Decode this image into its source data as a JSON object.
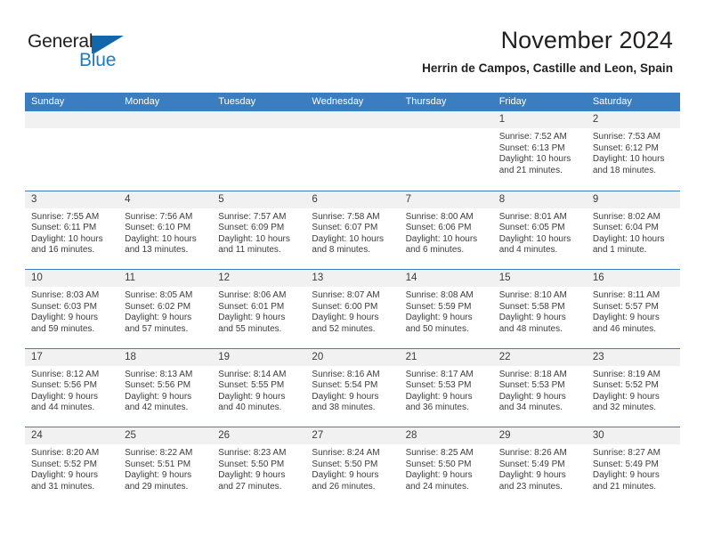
{
  "brand": {
    "name_part1": "General",
    "name_part2": "Blue",
    "flag_color": "#1466ab",
    "accent_color": "#1d7cc4"
  },
  "header": {
    "title": "November 2024",
    "subtitle": "Herrin de Campos, Castille and Leon, Spain"
  },
  "colors": {
    "header_row_bg": "#3a7ec1",
    "day_number_bg": "#f1f1f1",
    "text": "#3c3c3c",
    "page_bg": "#ffffff"
  },
  "weekdays": [
    "Sunday",
    "Monday",
    "Tuesday",
    "Wednesday",
    "Thursday",
    "Friday",
    "Saturday"
  ],
  "weeks": [
    [
      {
        "day": "",
        "empty": true,
        "sunrise": "",
        "sunset": "",
        "daylight1": "",
        "daylight2": ""
      },
      {
        "day": "",
        "empty": true,
        "sunrise": "",
        "sunset": "",
        "daylight1": "",
        "daylight2": ""
      },
      {
        "day": "",
        "empty": true,
        "sunrise": "",
        "sunset": "",
        "daylight1": "",
        "daylight2": ""
      },
      {
        "day": "",
        "empty": true,
        "sunrise": "",
        "sunset": "",
        "daylight1": "",
        "daylight2": ""
      },
      {
        "day": "",
        "empty": true,
        "sunrise": "",
        "sunset": "",
        "daylight1": "",
        "daylight2": ""
      },
      {
        "day": "1",
        "empty": false,
        "sunrise": "Sunrise: 7:52 AM",
        "sunset": "Sunset: 6:13 PM",
        "daylight1": "Daylight: 10 hours",
        "daylight2": "and 21 minutes."
      },
      {
        "day": "2",
        "empty": false,
        "sunrise": "Sunrise: 7:53 AM",
        "sunset": "Sunset: 6:12 PM",
        "daylight1": "Daylight: 10 hours",
        "daylight2": "and 18 minutes."
      }
    ],
    [
      {
        "day": "3",
        "empty": false,
        "sunrise": "Sunrise: 7:55 AM",
        "sunset": "Sunset: 6:11 PM",
        "daylight1": "Daylight: 10 hours",
        "daylight2": "and 16 minutes."
      },
      {
        "day": "4",
        "empty": false,
        "sunrise": "Sunrise: 7:56 AM",
        "sunset": "Sunset: 6:10 PM",
        "daylight1": "Daylight: 10 hours",
        "daylight2": "and 13 minutes."
      },
      {
        "day": "5",
        "empty": false,
        "sunrise": "Sunrise: 7:57 AM",
        "sunset": "Sunset: 6:09 PM",
        "daylight1": "Daylight: 10 hours",
        "daylight2": "and 11 minutes."
      },
      {
        "day": "6",
        "empty": false,
        "sunrise": "Sunrise: 7:58 AM",
        "sunset": "Sunset: 6:07 PM",
        "daylight1": "Daylight: 10 hours",
        "daylight2": "and 8 minutes."
      },
      {
        "day": "7",
        "empty": false,
        "sunrise": "Sunrise: 8:00 AM",
        "sunset": "Sunset: 6:06 PM",
        "daylight1": "Daylight: 10 hours",
        "daylight2": "and 6 minutes."
      },
      {
        "day": "8",
        "empty": false,
        "sunrise": "Sunrise: 8:01 AM",
        "sunset": "Sunset: 6:05 PM",
        "daylight1": "Daylight: 10 hours",
        "daylight2": "and 4 minutes."
      },
      {
        "day": "9",
        "empty": false,
        "sunrise": "Sunrise: 8:02 AM",
        "sunset": "Sunset: 6:04 PM",
        "daylight1": "Daylight: 10 hours",
        "daylight2": "and 1 minute."
      }
    ],
    [
      {
        "day": "10",
        "empty": false,
        "sunrise": "Sunrise: 8:03 AM",
        "sunset": "Sunset: 6:03 PM",
        "daylight1": "Daylight: 9 hours",
        "daylight2": "and 59 minutes."
      },
      {
        "day": "11",
        "empty": false,
        "sunrise": "Sunrise: 8:05 AM",
        "sunset": "Sunset: 6:02 PM",
        "daylight1": "Daylight: 9 hours",
        "daylight2": "and 57 minutes."
      },
      {
        "day": "12",
        "empty": false,
        "sunrise": "Sunrise: 8:06 AM",
        "sunset": "Sunset: 6:01 PM",
        "daylight1": "Daylight: 9 hours",
        "daylight2": "and 55 minutes."
      },
      {
        "day": "13",
        "empty": false,
        "sunrise": "Sunrise: 8:07 AM",
        "sunset": "Sunset: 6:00 PM",
        "daylight1": "Daylight: 9 hours",
        "daylight2": "and 52 minutes."
      },
      {
        "day": "14",
        "empty": false,
        "sunrise": "Sunrise: 8:08 AM",
        "sunset": "Sunset: 5:59 PM",
        "daylight1": "Daylight: 9 hours",
        "daylight2": "and 50 minutes."
      },
      {
        "day": "15",
        "empty": false,
        "sunrise": "Sunrise: 8:10 AM",
        "sunset": "Sunset: 5:58 PM",
        "daylight1": "Daylight: 9 hours",
        "daylight2": "and 48 minutes."
      },
      {
        "day": "16",
        "empty": false,
        "sunrise": "Sunrise: 8:11 AM",
        "sunset": "Sunset: 5:57 PM",
        "daylight1": "Daylight: 9 hours",
        "daylight2": "and 46 minutes."
      }
    ],
    [
      {
        "day": "17",
        "empty": false,
        "sunrise": "Sunrise: 8:12 AM",
        "sunset": "Sunset: 5:56 PM",
        "daylight1": "Daylight: 9 hours",
        "daylight2": "and 44 minutes."
      },
      {
        "day": "18",
        "empty": false,
        "sunrise": "Sunrise: 8:13 AM",
        "sunset": "Sunset: 5:56 PM",
        "daylight1": "Daylight: 9 hours",
        "daylight2": "and 42 minutes."
      },
      {
        "day": "19",
        "empty": false,
        "sunrise": "Sunrise: 8:14 AM",
        "sunset": "Sunset: 5:55 PM",
        "daylight1": "Daylight: 9 hours",
        "daylight2": "and 40 minutes."
      },
      {
        "day": "20",
        "empty": false,
        "sunrise": "Sunrise: 8:16 AM",
        "sunset": "Sunset: 5:54 PM",
        "daylight1": "Daylight: 9 hours",
        "daylight2": "and 38 minutes."
      },
      {
        "day": "21",
        "empty": false,
        "sunrise": "Sunrise: 8:17 AM",
        "sunset": "Sunset: 5:53 PM",
        "daylight1": "Daylight: 9 hours",
        "daylight2": "and 36 minutes."
      },
      {
        "day": "22",
        "empty": false,
        "sunrise": "Sunrise: 8:18 AM",
        "sunset": "Sunset: 5:53 PM",
        "daylight1": "Daylight: 9 hours",
        "daylight2": "and 34 minutes."
      },
      {
        "day": "23",
        "empty": false,
        "sunrise": "Sunrise: 8:19 AM",
        "sunset": "Sunset: 5:52 PM",
        "daylight1": "Daylight: 9 hours",
        "daylight2": "and 32 minutes."
      }
    ],
    [
      {
        "day": "24",
        "empty": false,
        "sunrise": "Sunrise: 8:20 AM",
        "sunset": "Sunset: 5:52 PM",
        "daylight1": "Daylight: 9 hours",
        "daylight2": "and 31 minutes."
      },
      {
        "day": "25",
        "empty": false,
        "sunrise": "Sunrise: 8:22 AM",
        "sunset": "Sunset: 5:51 PM",
        "daylight1": "Daylight: 9 hours",
        "daylight2": "and 29 minutes."
      },
      {
        "day": "26",
        "empty": false,
        "sunrise": "Sunrise: 8:23 AM",
        "sunset": "Sunset: 5:50 PM",
        "daylight1": "Daylight: 9 hours",
        "daylight2": "and 27 minutes."
      },
      {
        "day": "27",
        "empty": false,
        "sunrise": "Sunrise: 8:24 AM",
        "sunset": "Sunset: 5:50 PM",
        "daylight1": "Daylight: 9 hours",
        "daylight2": "and 26 minutes."
      },
      {
        "day": "28",
        "empty": false,
        "sunrise": "Sunrise: 8:25 AM",
        "sunset": "Sunset: 5:50 PM",
        "daylight1": "Daylight: 9 hours",
        "daylight2": "and 24 minutes."
      },
      {
        "day": "29",
        "empty": false,
        "sunrise": "Sunrise: 8:26 AM",
        "sunset": "Sunset: 5:49 PM",
        "daylight1": "Daylight: 9 hours",
        "daylight2": "and 23 minutes."
      },
      {
        "day": "30",
        "empty": false,
        "sunrise": "Sunrise: 8:27 AM",
        "sunset": "Sunset: 5:49 PM",
        "daylight1": "Daylight: 9 hours",
        "daylight2": "and 21 minutes."
      }
    ]
  ]
}
